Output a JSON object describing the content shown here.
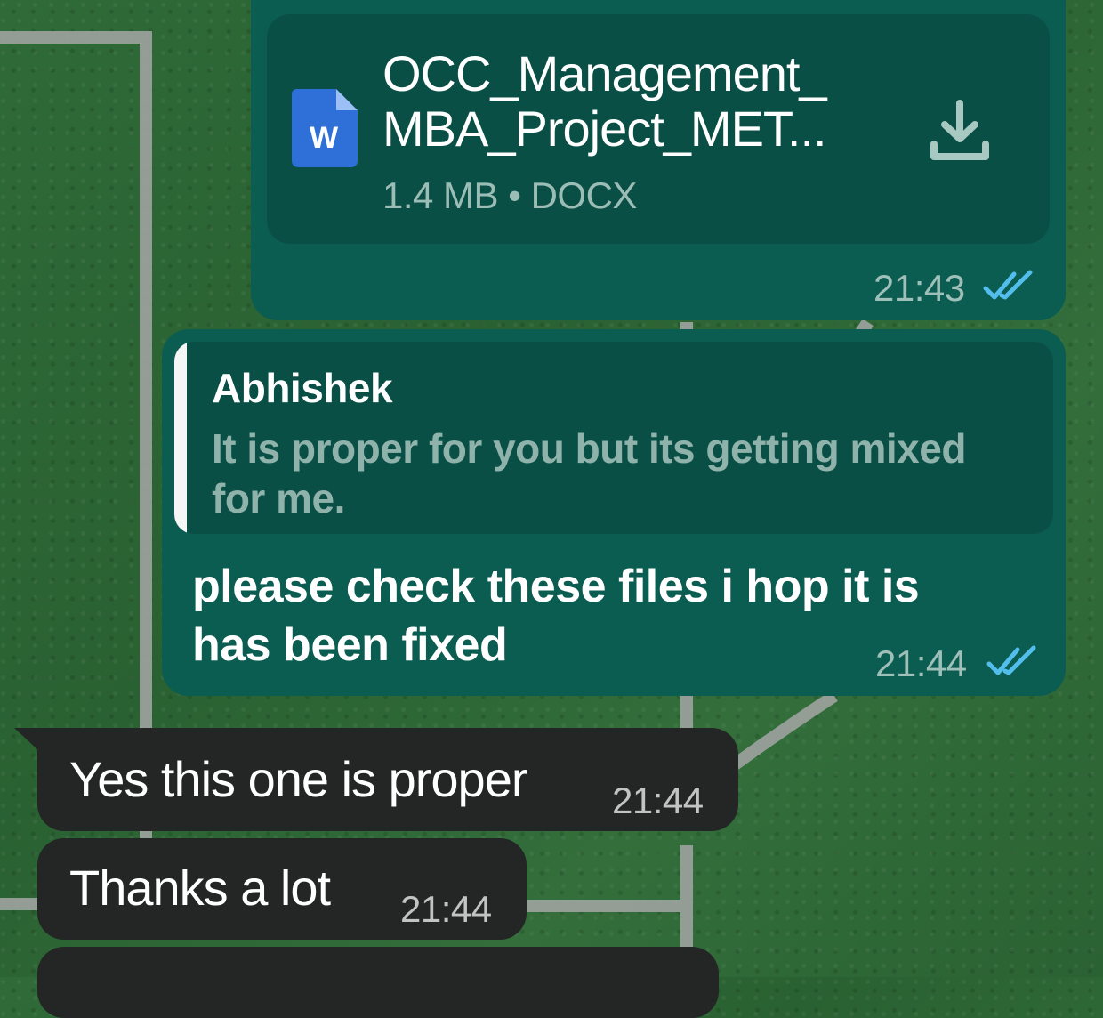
{
  "theme": {
    "outgoing_bubble": "#0b5c51",
    "outgoing_card": "#0a4f46",
    "incoming_bubble": "#232625",
    "read_tick": "#53bdeb",
    "wallpaper": "#2f6a38"
  },
  "messages": {
    "document": {
      "icon": "word-doc-icon",
      "file_name": "OCC_Management_\nMBA_Project_MET...",
      "meta": "1.4 MB • DOCX",
      "action_icon": "download-icon",
      "time": "21:43",
      "status": "read"
    },
    "reply": {
      "quoted_author": "Abhishek",
      "quoted_text": "It is proper for you but its getting mixed for me.",
      "text": "please check these files i hop it is has been fixed",
      "time": "21:44",
      "status": "read"
    },
    "incoming": [
      {
        "text": "Yes this one is proper",
        "time": "21:44"
      },
      {
        "text": "Thanks a lot",
        "time": "21:44"
      }
    ]
  }
}
